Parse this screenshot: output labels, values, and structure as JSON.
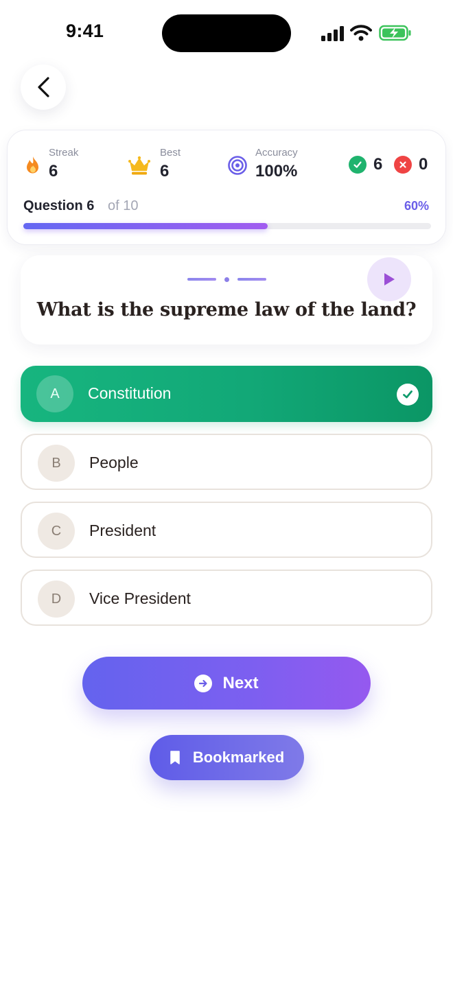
{
  "status_bar": {
    "time": "9:41"
  },
  "stats": {
    "streak": {
      "label": "Streak",
      "value": "6"
    },
    "best": {
      "label": "Best",
      "value": "6"
    },
    "accuracy": {
      "label": "Accuracy",
      "value": "100%"
    },
    "correct_count": "6",
    "wrong_count": "0"
  },
  "progress": {
    "question_label": "Question 6",
    "of_label": "of 10",
    "percent_label": "60%",
    "fraction": 0.6
  },
  "question": {
    "text": "What is the supreme law of the land?"
  },
  "options": [
    {
      "letter": "A",
      "text": "Constitution",
      "state": "correct"
    },
    {
      "letter": "B",
      "text": "People",
      "state": "default"
    },
    {
      "letter": "C",
      "text": "President",
      "state": "default"
    },
    {
      "letter": "D",
      "text": "Vice President",
      "state": "default"
    }
  ],
  "buttons": {
    "next": "Next",
    "bookmark": "Bookmarked"
  },
  "icons": {
    "back": "chevron-left-icon",
    "streak": "flame-icon",
    "best": "crown-icon",
    "accuracy": "target-icon",
    "correct": "check-circle-icon",
    "wrong": "x-circle-icon",
    "audio": "play-icon",
    "selected": "check-icon",
    "next": "arrow-right-circle-icon",
    "bookmark": "bookmark-icon"
  },
  "colors": {
    "accent_purple": "#6a5ee8",
    "correct_green": "#12a877",
    "wrong_red": "#ef4444",
    "streak_orange": "#f58a1f",
    "crown_yellow": "#f5b91c"
  }
}
